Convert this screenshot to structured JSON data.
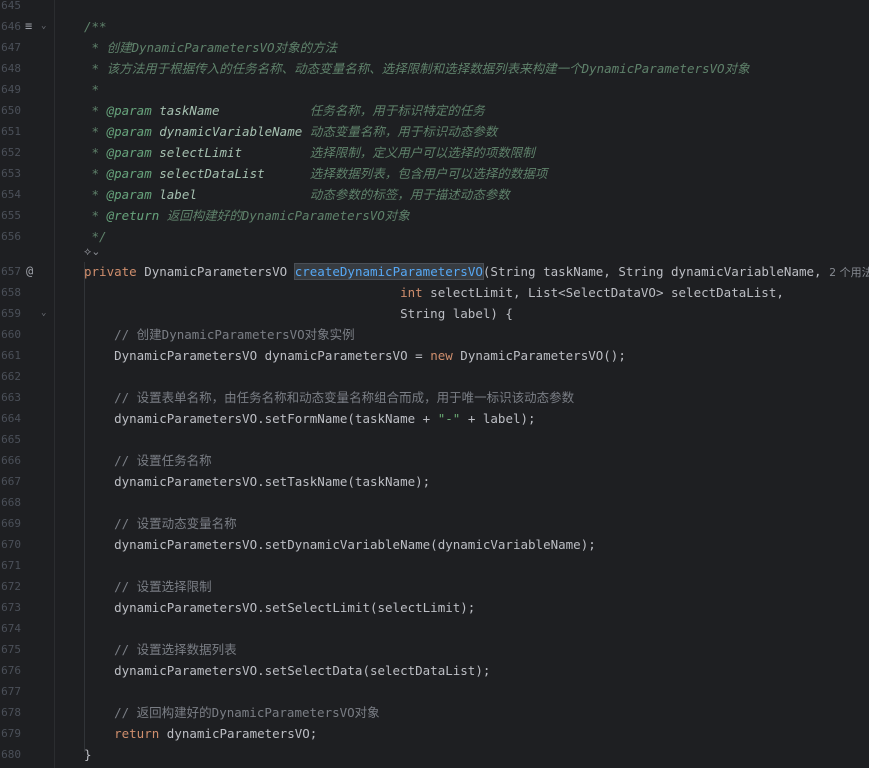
{
  "editor": {
    "lines": [
      {
        "n": "645",
        "tokens": []
      },
      {
        "n": "646",
        "tokens": [
          {
            "c": "doc",
            "t": "/**"
          }
        ]
      },
      {
        "n": "647",
        "tokens": [
          {
            "c": "doc",
            "t": " * 创建DynamicParametersVO对象的方法"
          }
        ]
      },
      {
        "n": "648",
        "tokens": [
          {
            "c": "doc",
            "t": " * 该方法用于根据传入的任务名称、动态变量名称、选择限制和选择数据列表来构建一个DynamicParametersVO对象"
          }
        ]
      },
      {
        "n": "649",
        "tokens": [
          {
            "c": "doc",
            "t": " *"
          }
        ]
      },
      {
        "n": "650",
        "tokens": [
          {
            "c": "doc",
            "t": " * "
          },
          {
            "c": "doctag",
            "t": "@param"
          },
          {
            "c": "docparam",
            "t": " taskName            "
          },
          {
            "c": "doc",
            "t": "任务名称，用于标识特定的任务"
          }
        ]
      },
      {
        "n": "651",
        "tokens": [
          {
            "c": "doc",
            "t": " * "
          },
          {
            "c": "doctag",
            "t": "@param"
          },
          {
            "c": "docparam",
            "t": " dynamicVariableName "
          },
          {
            "c": "doc",
            "t": "动态变量名称，用于标识动态参数"
          }
        ]
      },
      {
        "n": "652",
        "tokens": [
          {
            "c": "doc",
            "t": " * "
          },
          {
            "c": "doctag",
            "t": "@param"
          },
          {
            "c": "docparam",
            "t": " selectLimit         "
          },
          {
            "c": "doc",
            "t": "选择限制，定义用户可以选择的项数限制"
          }
        ]
      },
      {
        "n": "653",
        "tokens": [
          {
            "c": "doc",
            "t": " * "
          },
          {
            "c": "doctag",
            "t": "@param"
          },
          {
            "c": "docparam",
            "t": " selectDataList      "
          },
          {
            "c": "doc",
            "t": "选择数据列表，包含用户可以选择的数据项"
          }
        ]
      },
      {
        "n": "654",
        "tokens": [
          {
            "c": "doc",
            "t": " * "
          },
          {
            "c": "doctag",
            "t": "@param"
          },
          {
            "c": "docparam",
            "t": " label               "
          },
          {
            "c": "doc",
            "t": "动态参数的标签，用于描述动态参数"
          }
        ]
      },
      {
        "n": "655",
        "tokens": [
          {
            "c": "doc",
            "t": " * "
          },
          {
            "c": "doctag",
            "t": "@return"
          },
          {
            "c": "doc",
            "t": " 返回构建好的DynamicParametersVO对象"
          }
        ]
      },
      {
        "n": "656",
        "tokens": [
          {
            "c": "doc",
            "t": " */"
          }
        ]
      },
      {
        "n": "657",
        "tokens": [
          {
            "c": "kw",
            "t": "private "
          },
          {
            "c": "plain",
            "t": "DynamicParametersVO "
          },
          {
            "c": "fn hl",
            "t": "createDynamicParametersVO"
          },
          {
            "c": "plain",
            "t": "(String taskName, String dynamicVariableName, "
          }
        ]
      },
      {
        "n": "658",
        "tokens": [
          {
            "c": "plain",
            "t": "                                          "
          },
          {
            "c": "kw",
            "t": "int"
          },
          {
            "c": "plain",
            "t": " selectLimit, List<SelectDataVO> selectDataList,"
          }
        ]
      },
      {
        "n": "659",
        "tokens": [
          {
            "c": "plain",
            "t": "                                          String label) {"
          }
        ]
      },
      {
        "n": "660",
        "tokens": [
          {
            "c": "cmt",
            "t": "    // 创建DynamicParametersVO对象实例"
          }
        ]
      },
      {
        "n": "661",
        "tokens": [
          {
            "c": "plain",
            "t": "    DynamicParametersVO dynamicParametersVO = "
          },
          {
            "c": "kw",
            "t": "new"
          },
          {
            "c": "plain",
            "t": " DynamicParametersVO();"
          }
        ]
      },
      {
        "n": "662",
        "tokens": []
      },
      {
        "n": "663",
        "tokens": [
          {
            "c": "cmt",
            "t": "    // 设置表单名称，由任务名称和动态变量名称组合而成，用于唯一标识该动态参数"
          }
        ]
      },
      {
        "n": "664",
        "tokens": [
          {
            "c": "plain",
            "t": "    dynamicParametersVO.setFormName(taskName + "
          },
          {
            "c": "str",
            "t": "\"-\""
          },
          {
            "c": "plain",
            "t": " + label);"
          }
        ]
      },
      {
        "n": "665",
        "tokens": []
      },
      {
        "n": "666",
        "tokens": [
          {
            "c": "cmt",
            "t": "    // 设置任务名称"
          }
        ]
      },
      {
        "n": "667",
        "tokens": [
          {
            "c": "plain",
            "t": "    dynamicParametersVO.setTaskName(taskName);"
          }
        ]
      },
      {
        "n": "668",
        "tokens": []
      },
      {
        "n": "669",
        "tokens": [
          {
            "c": "cmt",
            "t": "    // 设置动态变量名称"
          }
        ]
      },
      {
        "n": "670",
        "tokens": [
          {
            "c": "plain",
            "t": "    dynamicParametersVO.setDynamicVariableName(dynamicVariableName);"
          }
        ]
      },
      {
        "n": "671",
        "tokens": []
      },
      {
        "n": "672",
        "tokens": [
          {
            "c": "cmt",
            "t": "    // 设置选择限制"
          }
        ]
      },
      {
        "n": "673",
        "tokens": [
          {
            "c": "plain",
            "t": "    dynamicParametersVO.setSelectLimit(selectLimit);"
          }
        ]
      },
      {
        "n": "674",
        "tokens": []
      },
      {
        "n": "675",
        "tokens": [
          {
            "c": "cmt",
            "t": "    // 设置选择数据列表"
          }
        ]
      },
      {
        "n": "676",
        "tokens": [
          {
            "c": "plain",
            "t": "    dynamicParametersVO.setSelectData(selectDataList);"
          }
        ]
      },
      {
        "n": "677",
        "tokens": []
      },
      {
        "n": "678",
        "tokens": [
          {
            "c": "cmt",
            "t": "    // 返回构建好的DynamicParametersVO对象"
          }
        ]
      },
      {
        "n": "679",
        "tokens": [
          {
            "c": "kw",
            "t": "    return"
          },
          {
            "c": "plain",
            "t": " dynamicParametersVO;"
          }
        ]
      },
      {
        "n": "680",
        "tokens": [
          {
            "c": "plain",
            "t": "}"
          }
        ]
      }
    ],
    "inlay_hints": {
      "usages": "2 个用法",
      "new": "新 *"
    },
    "gutter": {
      "doc_toggle_icon": "doc-render-toggle-icon",
      "override_marker_icon": "at-sign-icon",
      "fold_icon": "chevron-down-icon",
      "ai_assist_icon": "ai-assist-icon"
    }
  }
}
